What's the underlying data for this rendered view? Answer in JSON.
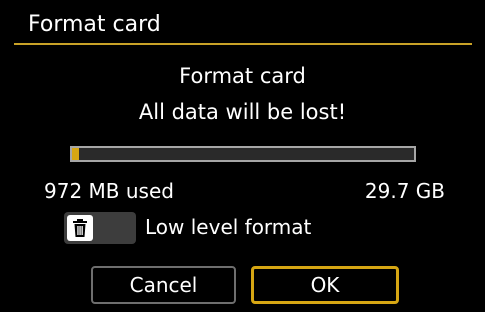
{
  "screen": {
    "title": "Format card"
  },
  "dialog": {
    "heading": "Format card",
    "warning": "All data will be lost!"
  },
  "usage": {
    "used_fraction": 0.02,
    "used_label": "972 MB used",
    "capacity_label": "29.7 GB"
  },
  "low_level_format": {
    "label": "Low level format",
    "enabled": false,
    "icon": "trash-icon"
  },
  "buttons": {
    "cancel_label": "Cancel",
    "ok_label": "OK"
  },
  "colors": {
    "accent": "#d6a613",
    "background": "#000000"
  }
}
